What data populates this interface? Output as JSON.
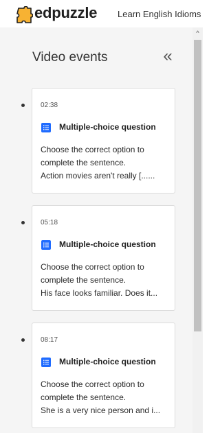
{
  "header": {
    "brand": "edpuzzle",
    "video_title": "Learn English Idioms w"
  },
  "panel": {
    "title": "Video events",
    "collapse_glyph": "«"
  },
  "events": [
    {
      "time": "02:38",
      "type": "Multiple-choice question",
      "lines": [
        "Choose the correct option to",
        "complete the sentence.",
        "Action movies aren't really [......"
      ]
    },
    {
      "time": "05:18",
      "type": "Multiple-choice question",
      "lines": [
        "Choose the correct option to",
        "complete the sentence.",
        "His face looks familiar. Does it..."
      ]
    },
    {
      "time": "08:17",
      "type": "Multiple-choice question",
      "lines": [
        "Choose the correct option to",
        "complete the sentence.",
        "She is a very nice person and i..."
      ]
    }
  ],
  "scrollbar": {
    "up_glyph": "^"
  },
  "colors": {
    "brand_yellow": "#f7b233",
    "question_icon_blue": "#1f6bff",
    "panel_background": "#f5f5f5"
  },
  "icons": {
    "logo": "edpuzzle-puzzle-icon",
    "collapse": "double-chevron-left-icon",
    "question": "list-icon"
  }
}
